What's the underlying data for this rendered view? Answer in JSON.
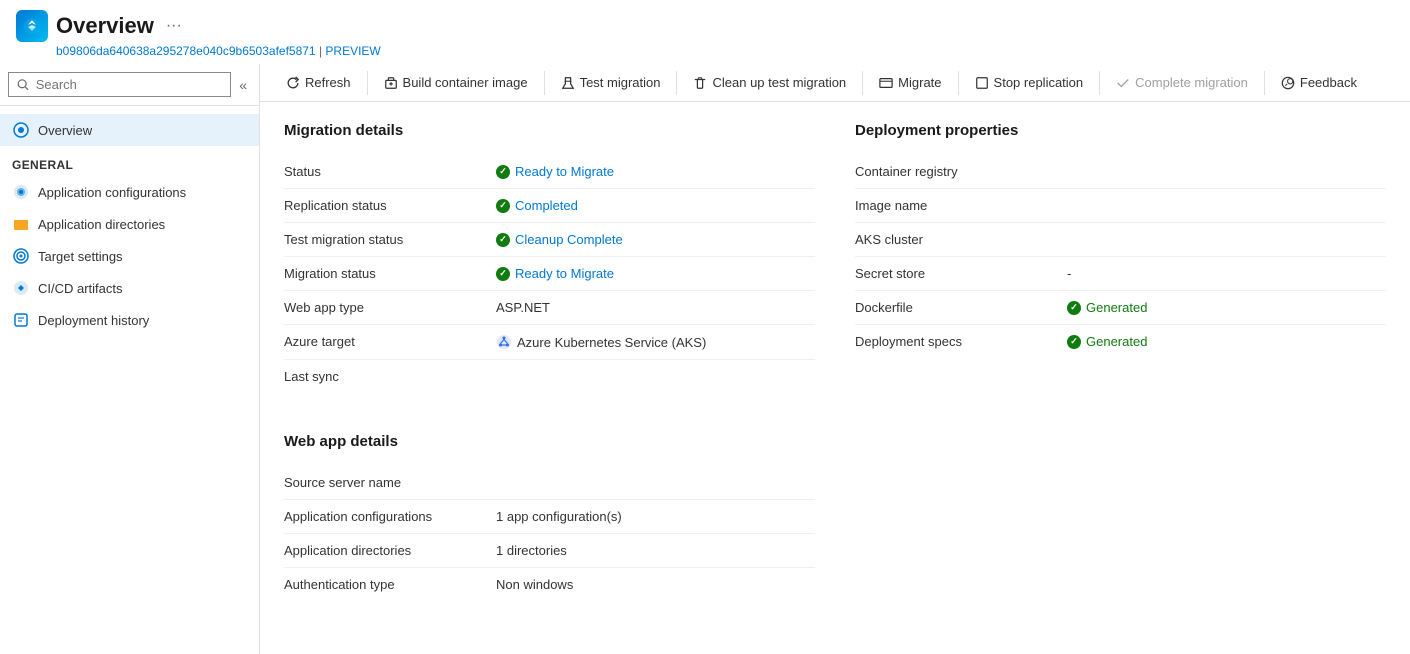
{
  "header": {
    "title": "Overview",
    "more": "···",
    "subtitle": "b09806da640638a295278e040c9b6503afef5871",
    "preview_label": "PREVIEW"
  },
  "sidebar": {
    "search_placeholder": "Search",
    "collapse_icon": "«",
    "nav": {
      "overview_label": "Overview",
      "general_label": "General",
      "items": [
        {
          "label": "Application configurations",
          "icon": "app-config-icon"
        },
        {
          "label": "Application directories",
          "icon": "app-dir-icon"
        },
        {
          "label": "Target settings",
          "icon": "target-icon"
        },
        {
          "label": "CI/CD artifacts",
          "icon": "cicd-icon"
        },
        {
          "label": "Deployment history",
          "icon": "deploy-icon"
        }
      ]
    }
  },
  "toolbar": {
    "buttons": [
      {
        "label": "Refresh",
        "icon": "refresh-icon",
        "disabled": false
      },
      {
        "label": "Build container image",
        "icon": "build-icon",
        "disabled": false
      },
      {
        "label": "Test migration",
        "icon": "test-icon",
        "disabled": false
      },
      {
        "label": "Clean up test migration",
        "icon": "cleanup-icon",
        "disabled": false
      },
      {
        "label": "Migrate",
        "icon": "migrate-icon",
        "disabled": false
      },
      {
        "label": "Stop replication",
        "icon": "stop-icon",
        "disabled": false
      },
      {
        "label": "Complete migration",
        "icon": "complete-icon",
        "disabled": true
      },
      {
        "label": "Feedback",
        "icon": "feedback-icon",
        "disabled": false
      }
    ]
  },
  "migration_details": {
    "title": "Migration details",
    "rows": [
      {
        "label": "Status",
        "value": "Ready to Migrate",
        "type": "status-green",
        "link": true
      },
      {
        "label": "Replication status",
        "value": "Completed",
        "type": "status-green",
        "link": true
      },
      {
        "label": "Test migration status",
        "value": "Cleanup Complete",
        "type": "status-green",
        "link": true
      },
      {
        "label": "Migration status",
        "value": "Ready to Migrate",
        "type": "status-green",
        "link": true
      },
      {
        "label": "Web app type",
        "value": "ASP.NET",
        "type": "plain"
      },
      {
        "label": "Azure target",
        "value": "Azure Kubernetes Service (AKS)",
        "type": "aks"
      },
      {
        "label": "Last sync",
        "value": "",
        "type": "plain"
      }
    ]
  },
  "deployment_properties": {
    "title": "Deployment properties",
    "rows": [
      {
        "label": "Container registry",
        "value": "",
        "type": "plain"
      },
      {
        "label": "Image name",
        "value": "",
        "type": "plain"
      },
      {
        "label": "AKS cluster",
        "value": "",
        "type": "plain"
      },
      {
        "label": "Secret store",
        "value": "-",
        "type": "plain"
      },
      {
        "label": "Dockerfile",
        "value": "Generated",
        "type": "status-green"
      },
      {
        "label": "Deployment specs",
        "value": "Generated",
        "type": "status-green"
      }
    ]
  },
  "web_app_details": {
    "title": "Web app details",
    "rows": [
      {
        "label": "Source server name",
        "value": "",
        "type": "plain"
      },
      {
        "label": "Application configurations",
        "value": "1 app configuration(s)",
        "type": "plain"
      },
      {
        "label": "Application directories",
        "value": "1 directories",
        "type": "plain"
      },
      {
        "label": "Authentication type",
        "value": "Non windows",
        "type": "plain"
      }
    ]
  }
}
